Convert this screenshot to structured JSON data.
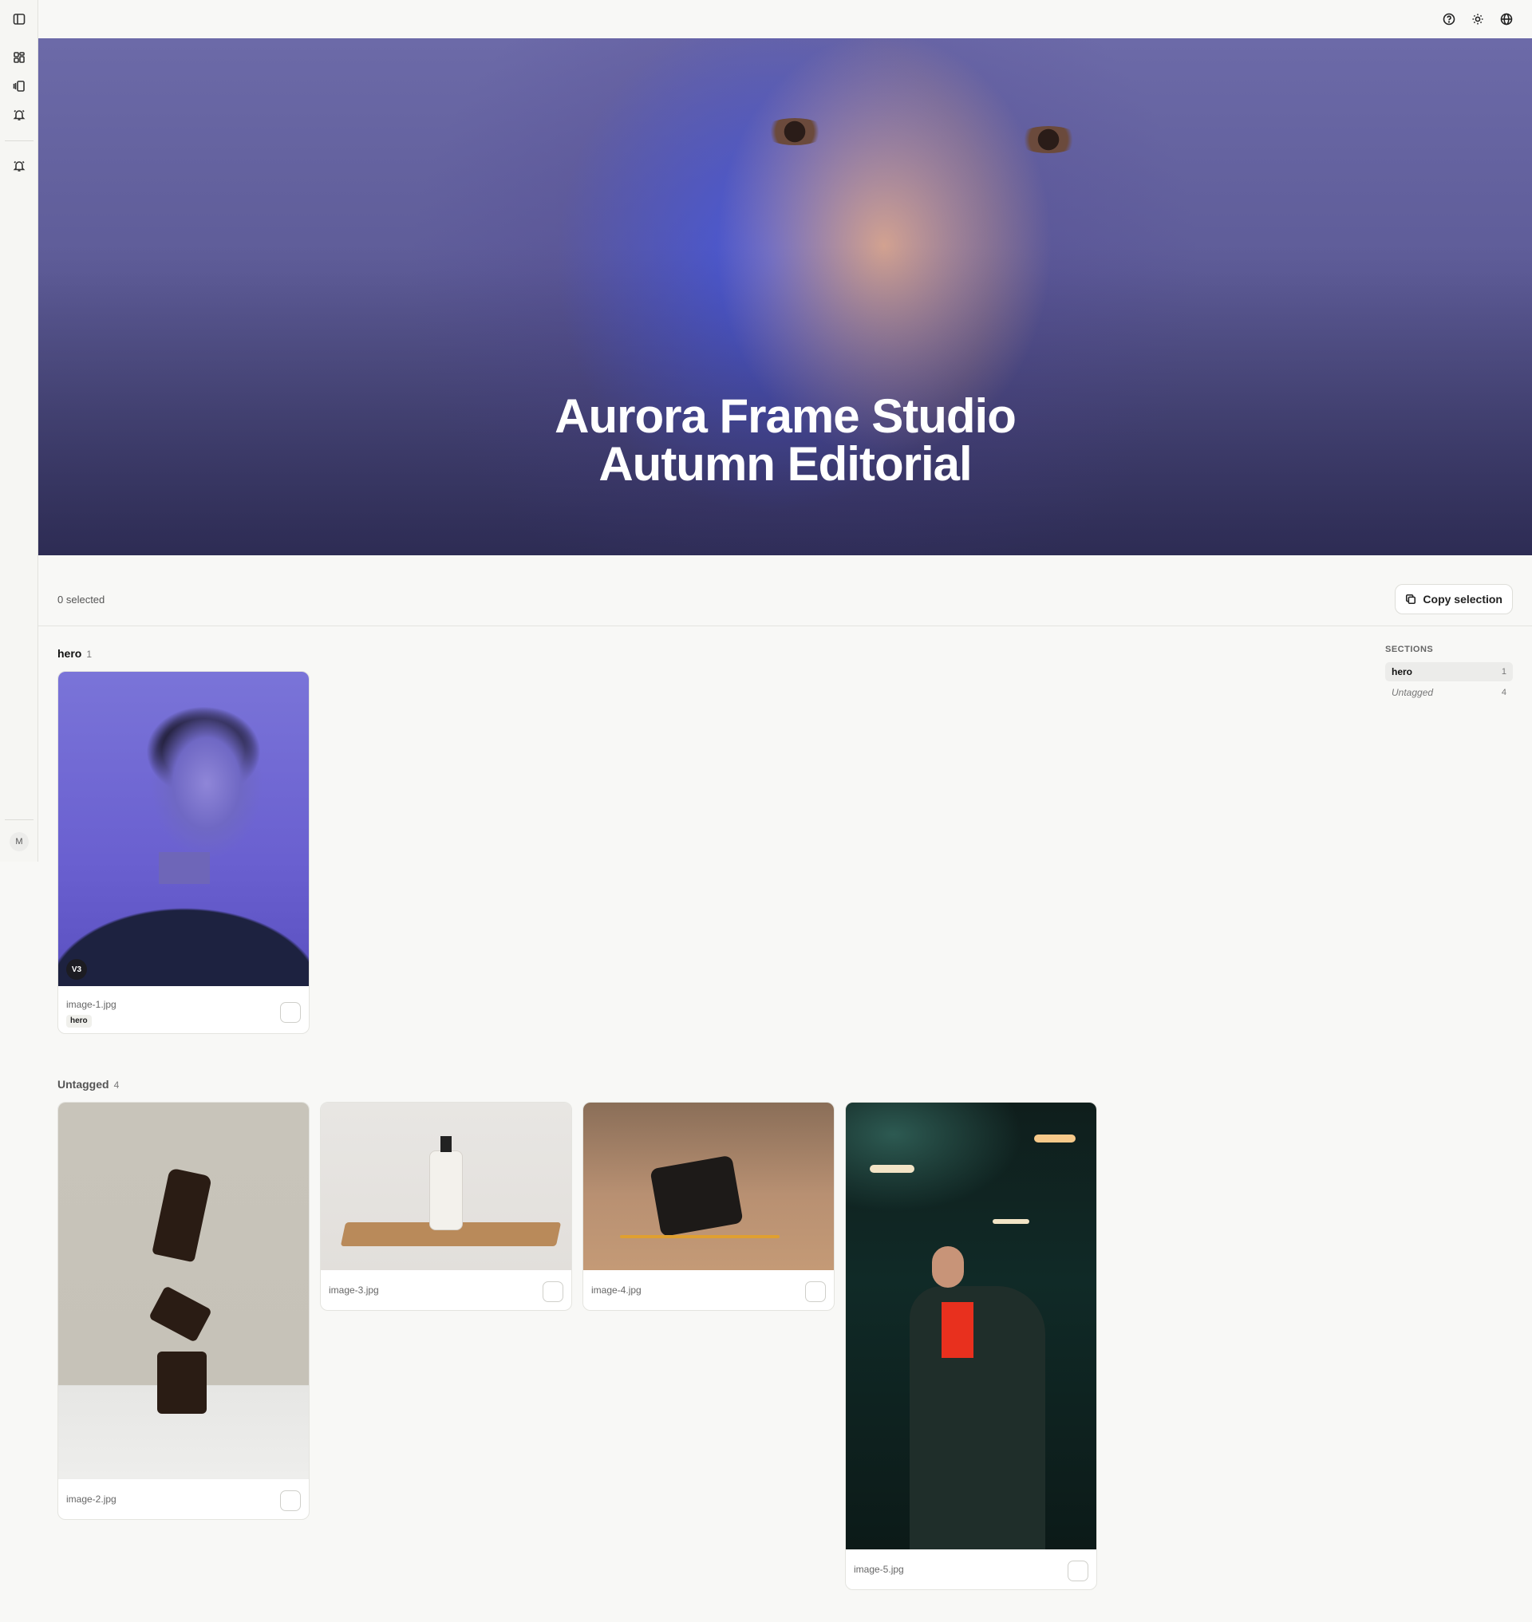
{
  "sidebar": {
    "icons": [
      "sidebar-toggle-icon",
      "grid-icon",
      "gallery-icon",
      "bell-icon",
      "bell-icon"
    ],
    "avatar_initial": "M"
  },
  "topbar": {
    "icons": [
      "help-icon",
      "sun-icon",
      "globe-icon"
    ]
  },
  "hero": {
    "title_line1": "Aurora Frame Studio",
    "title_line2": "Autumn Editorial"
  },
  "selection": {
    "count_text": "0 selected",
    "copy_label": "Copy selection"
  },
  "groups": [
    {
      "name": "hero",
      "count": "1",
      "images": [
        {
          "file": "image-1.jpg",
          "tag": "hero",
          "version": "V3"
        }
      ]
    },
    {
      "name": "Untagged",
      "count": "4",
      "images": [
        {
          "file": "image-2.jpg"
        },
        {
          "file": "image-3.jpg"
        },
        {
          "file": "image-4.jpg"
        },
        {
          "file": "image-5.jpg"
        }
      ]
    }
  ],
  "sections_nav": {
    "label": "SECTIONS",
    "items": [
      {
        "name": "hero",
        "count": "1"
      },
      {
        "name": "Untagged",
        "count": "4"
      }
    ]
  }
}
